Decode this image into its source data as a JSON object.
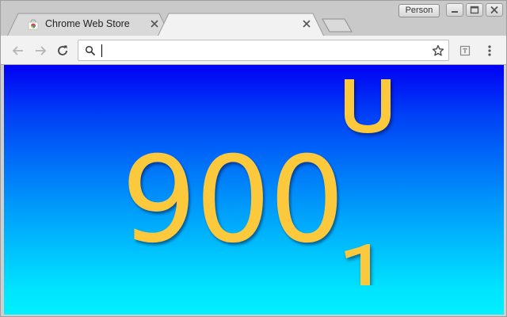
{
  "window": {
    "profile_label": "Person"
  },
  "tabs": [
    {
      "title": "Chrome Web Store",
      "active": false,
      "favicon": "chrome-web-store-icon"
    },
    {
      "title": "",
      "active": true
    }
  ],
  "toolbar": {
    "back_icon": "back-arrow-icon",
    "forward_icon": "forward-arrow-icon",
    "reload_icon": "reload-icon",
    "omnibox_value": "",
    "bookmark_icon": "star-icon",
    "extension_icon": "extension-icon",
    "menu_icon": "menu-dots-icon"
  },
  "page": {
    "number": "900",
    "colors": {
      "gradient_top": "#0000f4",
      "gradient_bottom": "#00f0ff",
      "text": "#fdc93c"
    }
  }
}
